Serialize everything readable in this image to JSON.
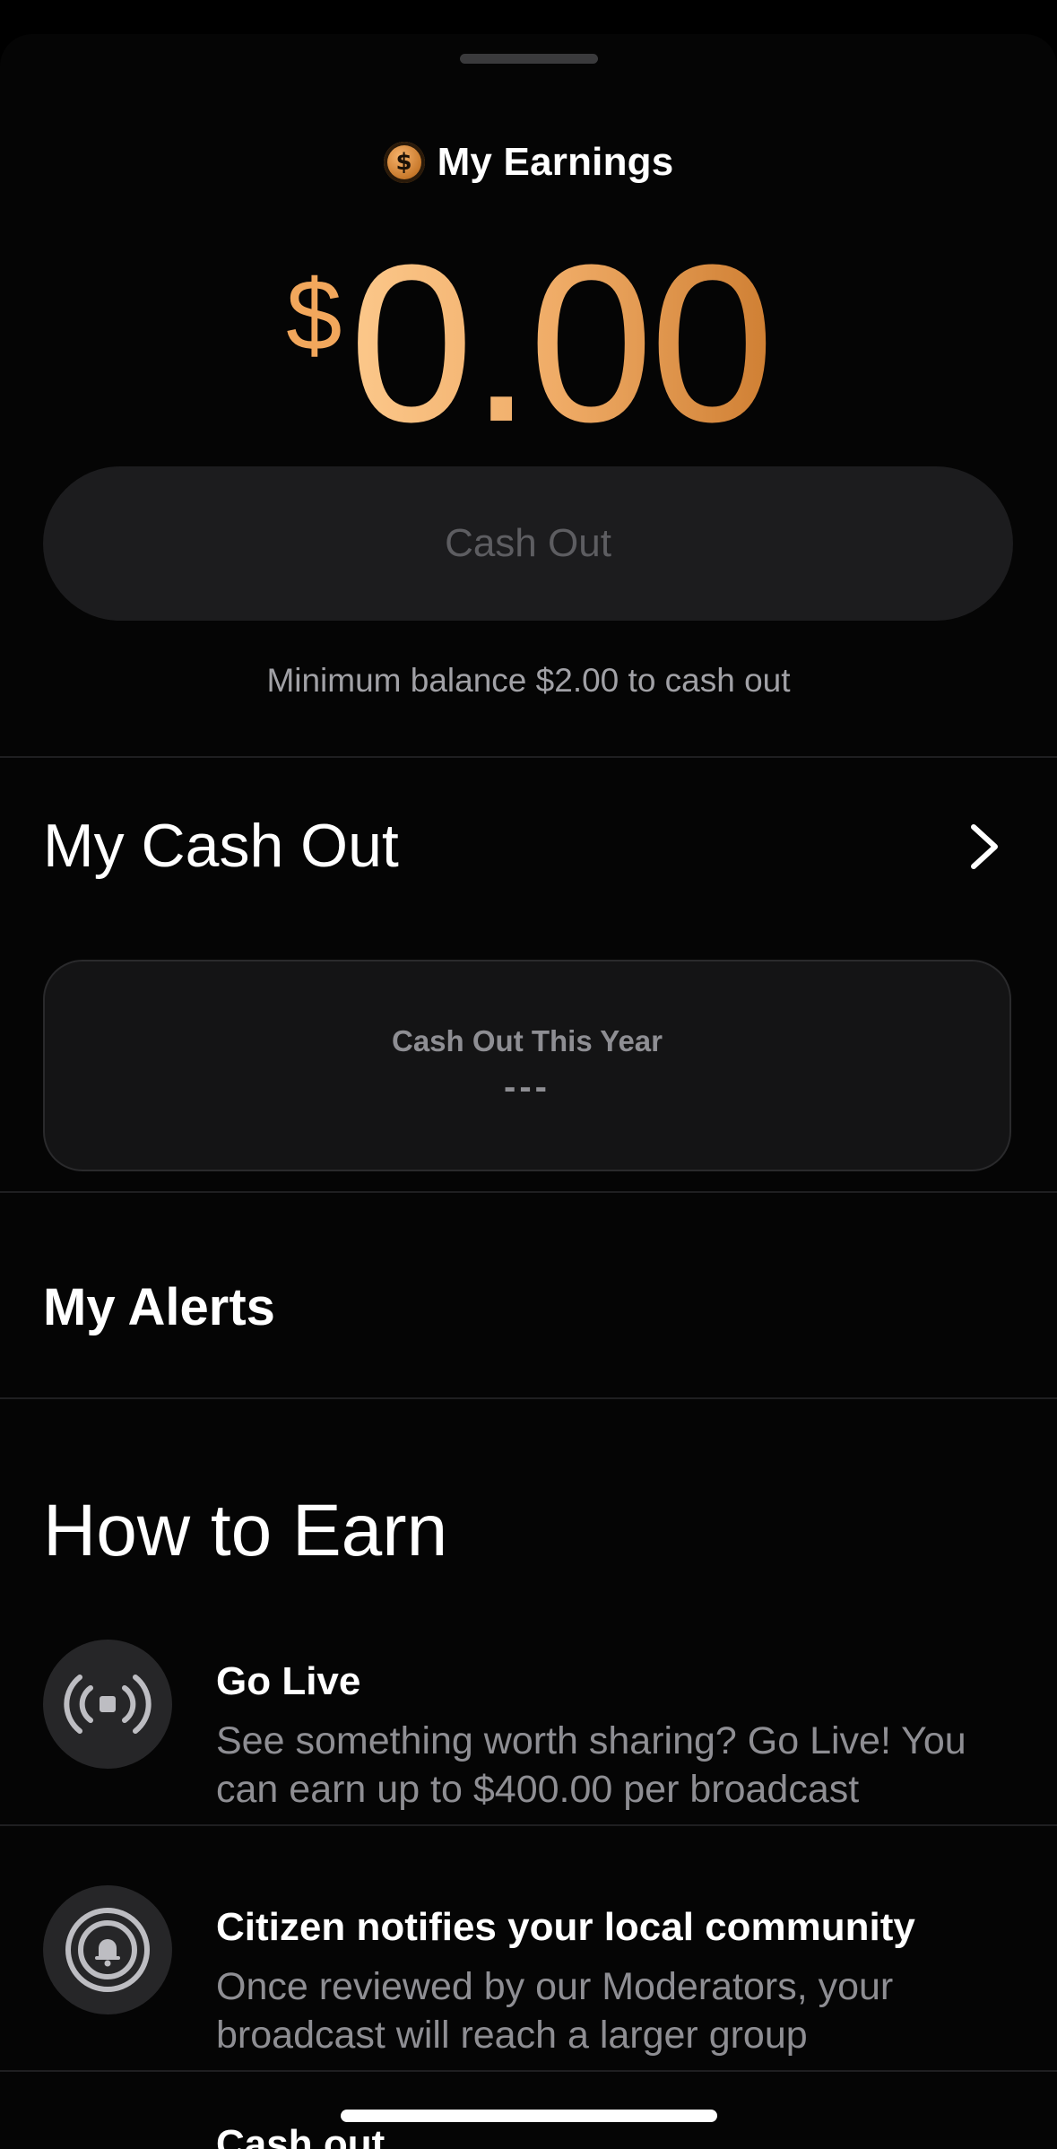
{
  "header": {
    "title": "My Earnings",
    "coin_icon": "dollar-coin-icon",
    "coin_glyph": "$"
  },
  "balance": {
    "currency": "$",
    "amount": "0.00"
  },
  "cash_out_button": {
    "label": "Cash Out"
  },
  "minimum_note": "Minimum balance $2.00 to cash out",
  "my_cash_out": {
    "title": "My Cash Out",
    "card_label": "Cash Out This Year",
    "card_value": "---"
  },
  "my_alerts": {
    "title": "My Alerts"
  },
  "how_to_earn": {
    "title": "How to Earn",
    "items": [
      {
        "icon": "broadcast-icon",
        "title": "Go Live",
        "description": "See something worth sharing? Go Live! You can earn up to $400.00 per broadcast"
      },
      {
        "icon": "community-bell-icon",
        "title": "Citizen notifies your local community",
        "description": "Once reviewed by our Moderators, your broadcast will reach a larger group"
      },
      {
        "icon": "cash-out-icon",
        "title": "Cash out",
        "description": ""
      }
    ]
  },
  "colors": {
    "accent_gold": "#efab66",
    "background": "#050505",
    "card": "#141415",
    "muted_text": "#8e8e93"
  }
}
